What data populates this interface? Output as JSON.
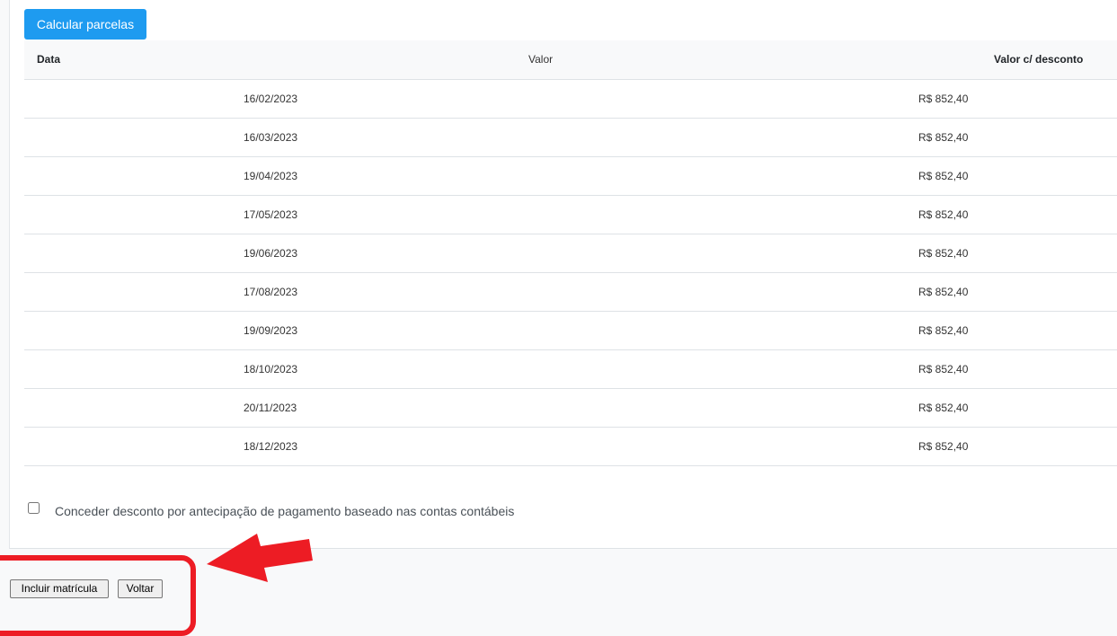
{
  "actions": {
    "calculate_label": "Calcular parcelas"
  },
  "table": {
    "headers": {
      "date": "Data",
      "value": "Valor",
      "discount_value": "Valor c/ desconto"
    },
    "rows": [
      {
        "date": "16/02/2023",
        "value": "R$ 852,40"
      },
      {
        "date": "16/03/2023",
        "value": "R$ 852,40"
      },
      {
        "date": "19/04/2023",
        "value": "R$ 852,40"
      },
      {
        "date": "17/05/2023",
        "value": "R$ 852,40"
      },
      {
        "date": "19/06/2023",
        "value": "R$ 852,40"
      },
      {
        "date": "17/08/2023",
        "value": "R$ 852,40"
      },
      {
        "date": "19/09/2023",
        "value": "R$ 852,40"
      },
      {
        "date": "18/10/2023",
        "value": "R$ 852,40"
      },
      {
        "date": "20/11/2023",
        "value": "R$ 852,40"
      },
      {
        "date": "18/12/2023",
        "value": "R$ 852,40"
      }
    ]
  },
  "discount_option": {
    "label": "Conceder desconto por antecipação de pagamento baseado nas contas contábeis",
    "checked": false
  },
  "footer": {
    "include_label": "Incluir matrícula",
    "back_label": "Voltar"
  },
  "annotation": {
    "color": "#ed1c24"
  }
}
